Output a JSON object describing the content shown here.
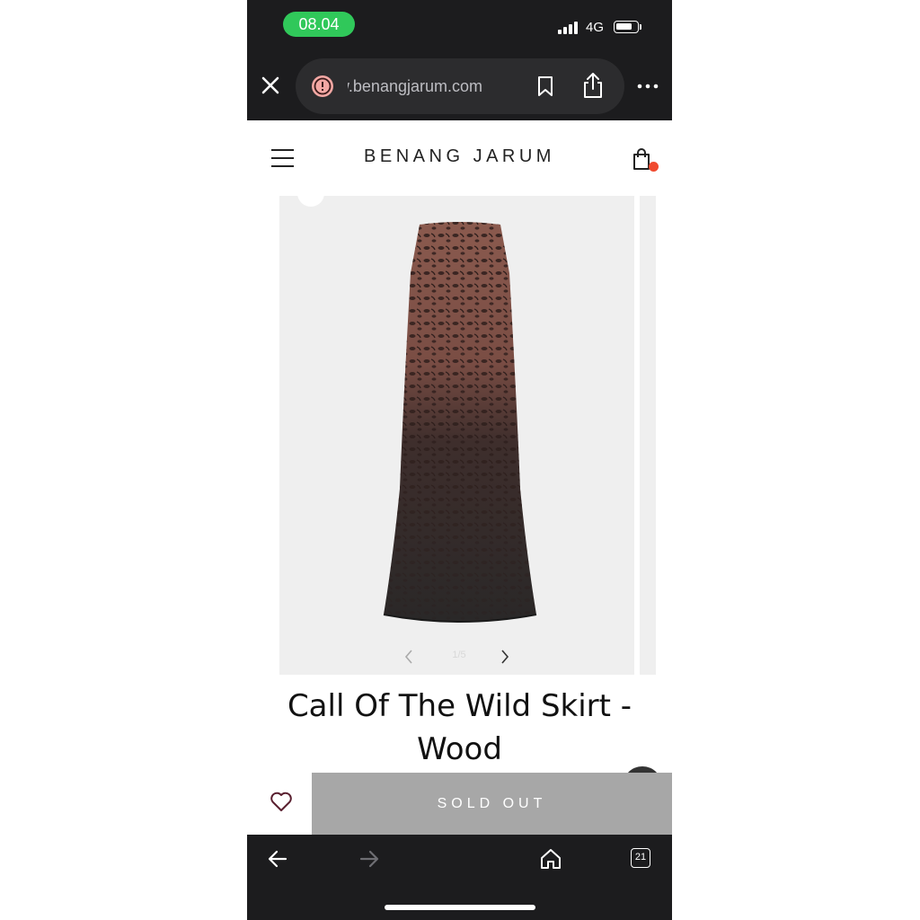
{
  "status_bar": {
    "time": "08.04",
    "network": "4G",
    "battery_level": 0.85
  },
  "browser": {
    "url": "www.benangjarum.com",
    "tab_count": "21"
  },
  "site": {
    "brand": "BENANG JARUM"
  },
  "product": {
    "title": "Call Of The Wild Skirt - Wood",
    "image_counter": "1/5",
    "sold_out_label": "SOLD OUT"
  },
  "icons": [
    "close-icon",
    "warning-icon",
    "bookmark-icon",
    "share-icon",
    "more-icon",
    "menu-icon",
    "shopping-bag-icon",
    "chevron-left-icon",
    "chevron-right-icon",
    "heart-icon",
    "back-arrow-icon",
    "forward-arrow-icon",
    "home-icon",
    "tabs-icon"
  ],
  "colors": {
    "status_pill": "#30c85a",
    "cart_badge": "#f04a2f",
    "sold_out_bg": "#a7a7a7",
    "browser_chrome": "#1c1c1e"
  }
}
